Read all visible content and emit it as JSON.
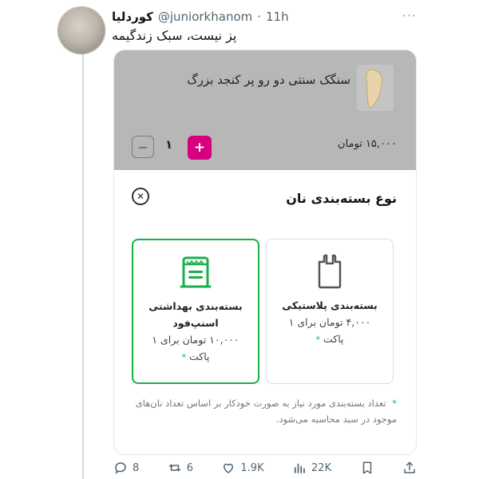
{
  "tweet": {
    "display_name": "کوردلیا",
    "handle": "@juniorkhanom",
    "dot": "·",
    "time": "11h",
    "more": "···",
    "text": "پز نیست، سبک زندگیمه"
  },
  "product": {
    "title": "سنگک سنتی دو رو پر کنجد بزرگ",
    "price": "۱۵,۰۰۰ تومان",
    "quantity": "۱",
    "minus_label": "−",
    "plus_label": "+"
  },
  "sheet": {
    "title": "نوع بسته‌بندی نان",
    "close_label": "✕",
    "options": [
      {
        "title": "بسته‌بندی بهداشتی اسنپ‌فود",
        "price": "۱۰,۰۰۰ تومان برای ۱",
        "unit": "پاکت",
        "star": "*",
        "selected": true,
        "icon": "paper-bag-icon"
      },
      {
        "title": "بسته‌بندی پلاستیکی",
        "price": "۴,۰۰۰ تومان برای ۱",
        "unit": "پاکت",
        "star": "*",
        "selected": false,
        "icon": "plastic-bag-icon"
      }
    ],
    "note_bullet": "*",
    "note": "تعداد بسته‌بندی مورد نیاز به صورت خودکار بر اساس تعداد نان‌های موجود در سبد محاسبه می‌شود."
  },
  "actions": {
    "replies": "8",
    "retweets": "6",
    "likes": "1.9K",
    "views": "22K"
  },
  "colors": {
    "accent_green": "#19b04a",
    "brand_pink": "#d6007e",
    "overlay_gray": "#b7b7b7"
  }
}
